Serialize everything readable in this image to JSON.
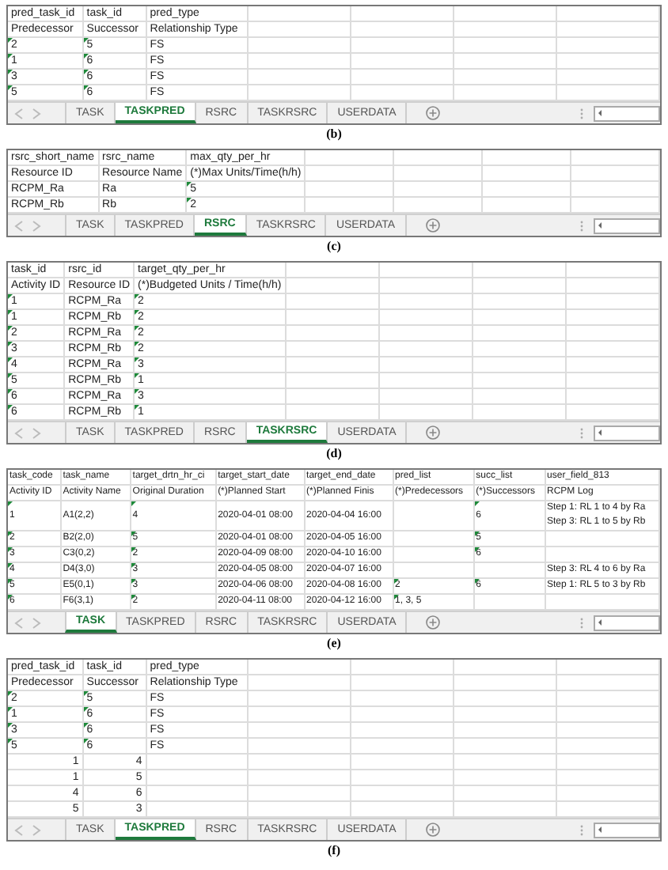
{
  "panels": [
    {
      "caption": "(b)",
      "tabs": [
        {
          "label": "TASK",
          "selected": false
        },
        {
          "label": "TASKPRED",
          "selected": true
        },
        {
          "label": "RSRC",
          "selected": false
        },
        {
          "label": "TASKRSRC",
          "selected": false
        },
        {
          "label": "USERDATA",
          "selected": false
        }
      ],
      "rows": [
        [
          "pred_task_id",
          "task_id",
          "pred_type"
        ],
        [
          "Predecessor",
          "Successor",
          "Relationship Type"
        ],
        [
          {
            "text": "2",
            "flagged": true
          },
          {
            "text": "5",
            "flagged": true
          },
          "FS"
        ],
        [
          {
            "text": "1",
            "flagged": true
          },
          {
            "text": "6",
            "flagged": true
          },
          "FS"
        ],
        [
          {
            "text": "3",
            "flagged": true
          },
          {
            "text": "6",
            "flagged": true
          },
          "FS"
        ],
        [
          {
            "text": "5",
            "flagged": true
          },
          {
            "text": "6",
            "flagged": true
          },
          "FS"
        ]
      ]
    },
    {
      "caption": "(c)",
      "tabs": [
        {
          "label": "TASK",
          "selected": false
        },
        {
          "label": "TASKPRED",
          "selected": false
        },
        {
          "label": "RSRC",
          "selected": true
        },
        {
          "label": "TASKRSRC",
          "selected": false
        },
        {
          "label": "USERDATA",
          "selected": false
        }
      ],
      "rows": [
        [
          "rsrc_short_name",
          "rsrc_name",
          "max_qty_per_hr"
        ],
        [
          "Resource ID",
          "Resource Name",
          "(*)Max Units/Time(h/h)"
        ],
        [
          "RCPM_Ra",
          "Ra",
          {
            "text": "5",
            "flagged": true
          }
        ],
        [
          "RCPM_Rb",
          "Rb",
          {
            "text": "2",
            "flagged": true
          }
        ]
      ]
    },
    {
      "caption": "(d)",
      "tabs": [
        {
          "label": "TASK",
          "selected": false
        },
        {
          "label": "TASKPRED",
          "selected": false
        },
        {
          "label": "RSRC",
          "selected": false
        },
        {
          "label": "TASKRSRC",
          "selected": true
        },
        {
          "label": "USERDATA",
          "selected": false
        }
      ],
      "rows": [
        [
          "task_id",
          "rsrc_id",
          "target_qty_per_hr"
        ],
        [
          "Activity ID",
          "Resource ID",
          "(*)Budgeted Units / Time(h/h)"
        ],
        [
          {
            "text": "1",
            "flagged": true
          },
          "RCPM_Ra",
          {
            "text": "2",
            "flagged": true
          }
        ],
        [
          {
            "text": "1",
            "flagged": true
          },
          "RCPM_Rb",
          {
            "text": "2",
            "flagged": true
          }
        ],
        [
          {
            "text": "2",
            "flagged": true
          },
          "RCPM_Ra",
          {
            "text": "2",
            "flagged": true
          }
        ],
        [
          {
            "text": "3",
            "flagged": true
          },
          "RCPM_Rb",
          {
            "text": "2",
            "flagged": true
          }
        ],
        [
          {
            "text": "4",
            "flagged": true
          },
          "RCPM_Ra",
          {
            "text": "3",
            "flagged": true
          }
        ],
        [
          {
            "text": "5",
            "flagged": true
          },
          "RCPM_Rb",
          {
            "text": "1",
            "flagged": true
          }
        ],
        [
          {
            "text": "6",
            "flagged": true
          },
          "RCPM_Ra",
          {
            "text": "3",
            "flagged": true
          }
        ],
        [
          {
            "text": "6",
            "flagged": true
          },
          "RCPM_Rb",
          {
            "text": "1",
            "flagged": true
          }
        ]
      ]
    },
    {
      "caption": "(e)",
      "tabs": [
        {
          "label": "TASK",
          "selected": true
        },
        {
          "label": "TASKPRED",
          "selected": false
        },
        {
          "label": "RSRC",
          "selected": false
        },
        {
          "label": "TASKRSRC",
          "selected": false
        },
        {
          "label": "USERDATA",
          "selected": false
        }
      ],
      "rows": [
        [
          "task_code",
          "task_name",
          "target_drtn_hr_ci",
          "target_start_date",
          "target_end_date",
          "pred_list",
          "succ_list",
          "user_field_813"
        ],
        [
          "Activity ID",
          "Activity Name",
          "Original Duration",
          "(*)Planned Start",
          "(*)Planned Finis",
          "(*)Predecessors",
          "(*)Successors",
          "RCPM Log"
        ],
        [
          {
            "text": "1",
            "flagged": true
          },
          "A1(2,2)",
          {
            "text": "4",
            "flagged": true
          },
          "2020-04-01 08:00",
          "2020-04-04 16:00",
          "",
          {
            "text": "6",
            "flagged": true
          },
          "Step 1: RL 1 to 4 by Ra\nStep 3: RL 1 to 5 by Rb"
        ],
        [
          {
            "text": "2",
            "flagged": true
          },
          "B2(2,0)",
          {
            "text": "5",
            "flagged": true
          },
          "2020-04-01 08:00",
          "2020-04-05 16:00",
          "",
          {
            "text": "5",
            "flagged": true
          },
          ""
        ],
        [
          {
            "text": "3",
            "flagged": true
          },
          "C3(0,2)",
          {
            "text": "2",
            "flagged": true
          },
          "2020-04-09 08:00",
          "2020-04-10 16:00",
          "",
          {
            "text": "6",
            "flagged": true
          },
          ""
        ],
        [
          {
            "text": "4",
            "flagged": true
          },
          "D4(3,0)",
          {
            "text": "3",
            "flagged": true
          },
          "2020-04-05 08:00",
          "2020-04-07 16:00",
          "",
          "",
          "Step 3: RL 4 to 6 by Ra"
        ],
        [
          {
            "text": "5",
            "flagged": true
          },
          "E5(0,1)",
          {
            "text": "3",
            "flagged": true
          },
          "2020-04-06 08:00",
          "2020-04-08 16:00",
          {
            "text": "2",
            "flagged": true
          },
          {
            "text": "6",
            "flagged": true
          },
          "Step 1: RL 5 to 3 by Rb"
        ],
        [
          {
            "text": "6",
            "flagged": true
          },
          "F6(3,1)",
          {
            "text": "2",
            "flagged": true
          },
          "2020-04-11 08:00",
          "2020-04-12 16:00",
          {
            "text": "1, 3, 5",
            "flagged": true
          },
          "",
          ""
        ]
      ]
    },
    {
      "caption": "(f)",
      "tabs": [
        {
          "label": "TASK",
          "selected": false
        },
        {
          "label": "TASKPRED",
          "selected": true
        },
        {
          "label": "RSRC",
          "selected": false
        },
        {
          "label": "TASKRSRC",
          "selected": false
        },
        {
          "label": "USERDATA",
          "selected": false
        }
      ],
      "rows": [
        [
          "pred_task_id",
          "task_id",
          "pred_type"
        ],
        [
          "Predecessor",
          "Successor",
          "Relationship Type"
        ],
        [
          {
            "text": "2",
            "flagged": true
          },
          {
            "text": "5",
            "flagged": true
          },
          "FS"
        ],
        [
          {
            "text": "1",
            "flagged": true
          },
          {
            "text": "6",
            "flagged": true
          },
          "FS"
        ],
        [
          {
            "text": "3",
            "flagged": true
          },
          {
            "text": "6",
            "flagged": true
          },
          "FS"
        ],
        [
          {
            "text": "5",
            "flagged": true
          },
          {
            "text": "6",
            "flagged": true
          },
          "FS"
        ],
        [
          {
            "text": "1",
            "numeric": true
          },
          {
            "text": "4",
            "numeric": true
          },
          ""
        ],
        [
          {
            "text": "1",
            "numeric": true
          },
          {
            "text": "5",
            "numeric": true
          },
          ""
        ],
        [
          {
            "text": "4",
            "numeric": true
          },
          {
            "text": "6",
            "numeric": true
          },
          ""
        ],
        [
          {
            "text": "5",
            "numeric": true
          },
          {
            "text": "3",
            "numeric": true
          },
          ""
        ]
      ]
    }
  ]
}
